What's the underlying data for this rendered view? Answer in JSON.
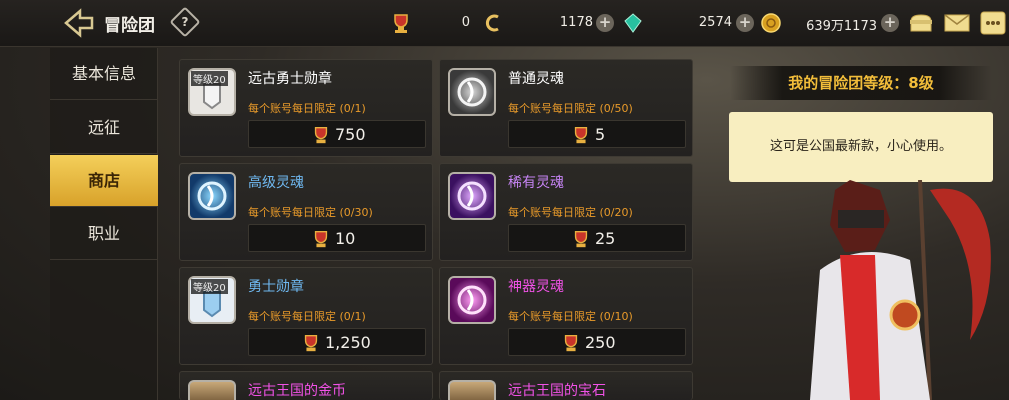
{
  "header": {
    "title": "冒险团",
    "help_glyph": "?",
    "currencies": [
      {
        "icon": "trophy-icon",
        "value": "0"
      },
      {
        "icon": "coin-c-icon",
        "value": "1178"
      },
      {
        "icon": "gem-icon",
        "value": "2574"
      },
      {
        "icon": "gold-coin-icon",
        "value": "639万1173"
      }
    ],
    "plus_glyph": "+"
  },
  "sidebar": {
    "items": [
      {
        "label": "基本信息",
        "active": false
      },
      {
        "label": "远征",
        "active": false
      },
      {
        "label": "商店",
        "active": true
      },
      {
        "label": "职业",
        "active": false
      }
    ]
  },
  "shop": {
    "items": [
      {
        "name": "远古勇士勋章",
        "name_color": "#ffffff",
        "badge": "等级20",
        "limit": "每个账号每日限定 (0/1)",
        "price": "750"
      },
      {
        "name": "普通灵魂",
        "name_color": "#ffffff",
        "badge": "",
        "limit": "每个账号每日限定 (0/50)",
        "price": "5"
      },
      {
        "name": "高级灵魂",
        "name_color": "#6fb8f0",
        "badge": "",
        "limit": "每个账号每日限定 (0/30)",
        "price": "10"
      },
      {
        "name": "稀有灵魂",
        "name_color": "#c684f4",
        "badge": "",
        "limit": "每个账号每日限定 (0/20)",
        "price": "25"
      },
      {
        "name": "勇士勋章",
        "name_color": "#6fb8f0",
        "badge": "等级20",
        "limit": "每个账号每日限定 (0/1)",
        "price": "1,250"
      },
      {
        "name": "神器灵魂",
        "name_color": "#f052e6",
        "badge": "",
        "limit": "每个账号每日限定 (0/10)",
        "price": "250"
      },
      {
        "name": "远古王国的金币",
        "name_color": "#f052e6",
        "badge": "",
        "limit": "",
        "price": ""
      },
      {
        "name": "远古王国的宝石",
        "name_color": "#f052e6",
        "badge": "",
        "limit": "",
        "price": ""
      }
    ]
  },
  "right_panel": {
    "level_text": "我的冒险团等级：8级",
    "npc_dialog": "这可是公国最新款，小心使用。"
  },
  "colors": {
    "accent": "#f2bd3a",
    "limit_text": "#e89a2a"
  }
}
